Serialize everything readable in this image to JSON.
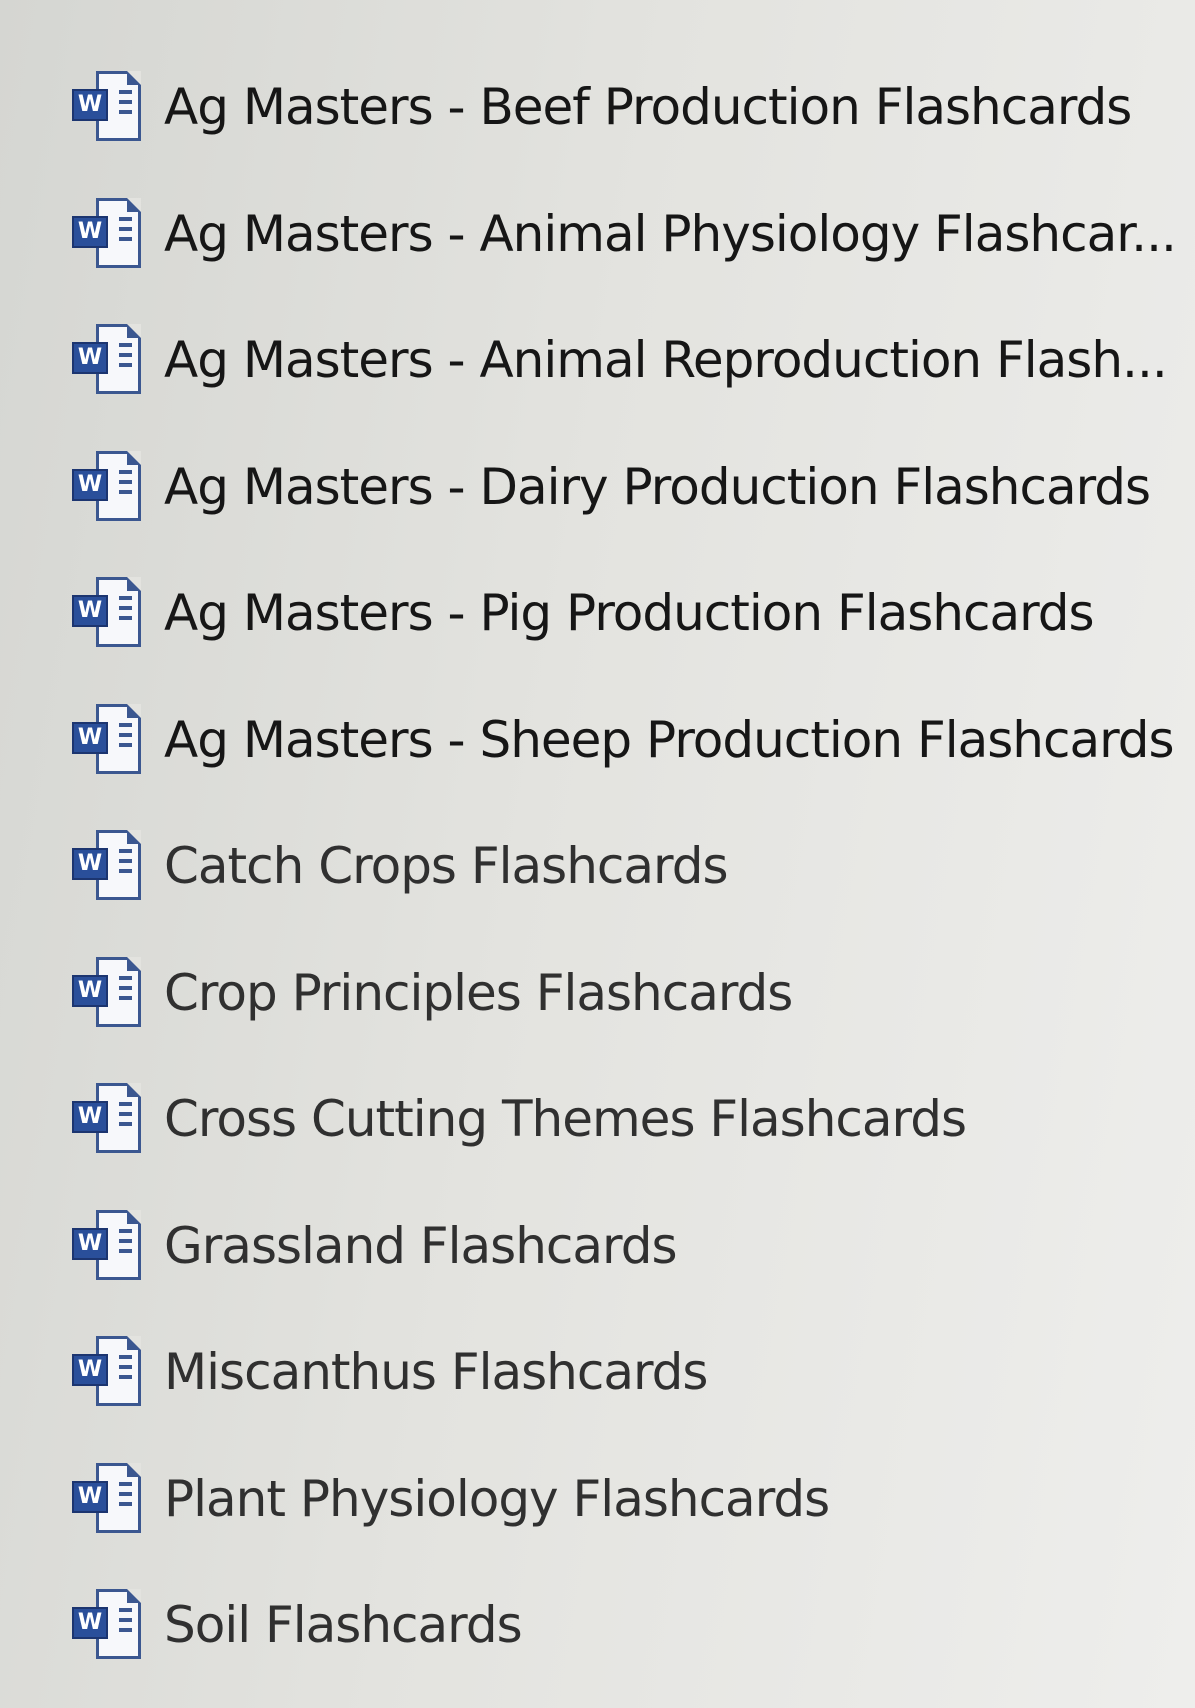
{
  "file_list": {
    "icon": "word-document-icon",
    "items": [
      {
        "label": "Ag Masters -  Beef Production Flashcards"
      },
      {
        "label": "Ag Masters - Animal Physiology Flashcar..."
      },
      {
        "label": "Ag Masters - Animal Reproduction Flash..."
      },
      {
        "label": "Ag Masters - Dairy Production Flashcards"
      },
      {
        "label": "Ag Masters - Pig Production Flashcards"
      },
      {
        "label": "Ag Masters - Sheep Production Flashcards"
      },
      {
        "label": "Catch Crops Flashcards"
      },
      {
        "label": "Crop Principles Flashcards"
      },
      {
        "label": "Cross Cutting Themes Flashcards"
      },
      {
        "label": "Grassland Flashcards"
      },
      {
        "label": "Miscanthus Flashcards"
      },
      {
        "label": "Plant Physiology Flashcards"
      },
      {
        "label": "Soil Flashcards"
      }
    ]
  }
}
